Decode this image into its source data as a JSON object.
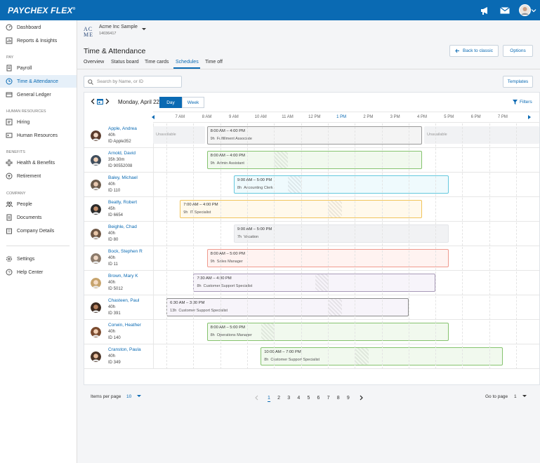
{
  "brand": {
    "logo_text": "PAYCHEX FLEX",
    "logo_mark": "®",
    "primary_color": "#0a6ab3"
  },
  "topbar": {
    "icons": [
      "megaphone-icon",
      "mail-icon",
      "avatar",
      "chevron-down-icon"
    ]
  },
  "sidebar": {
    "items_top": [
      {
        "label": "Dashboard",
        "icon": "dashboard-icon"
      },
      {
        "label": "Reports & Insights",
        "icon": "reports-icon"
      }
    ],
    "sections": [
      {
        "title": "PAY",
        "items": [
          {
            "label": "Payroll",
            "icon": "payroll-icon"
          },
          {
            "label": "Time & Attendance",
            "icon": "clock-icon",
            "active": true
          },
          {
            "label": "General Ledger",
            "icon": "ledger-icon"
          }
        ]
      },
      {
        "title": "HUMAN RESOURCES",
        "items": [
          {
            "label": "Hiring",
            "icon": "hiring-icon"
          },
          {
            "label": "Human Resources",
            "icon": "hr-icon"
          }
        ]
      },
      {
        "title": "BENEFITS",
        "items": [
          {
            "label": "Health & Benefits",
            "icon": "health-icon"
          },
          {
            "label": "Retirement",
            "icon": "retirement-icon"
          }
        ]
      },
      {
        "title": "COMPANY",
        "items": [
          {
            "label": "People",
            "icon": "people-icon"
          },
          {
            "label": "Documents",
            "icon": "documents-icon"
          },
          {
            "label": "Company Details",
            "icon": "company-icon"
          }
        ]
      }
    ],
    "items_bottom": [
      {
        "label": "Settings",
        "icon": "gear-icon"
      },
      {
        "label": "Help Center",
        "icon": "help-icon"
      }
    ]
  },
  "company": {
    "logo_line1": "AC",
    "logo_line2": "ME",
    "name": "Acme Inc Sample",
    "id": "14036417"
  },
  "page": {
    "title": "Time & Attendance",
    "back_label": "Back to classic",
    "options_label": "Options"
  },
  "tabs": [
    "Overview",
    "Status board",
    "Time cards",
    "Schedules",
    "Time off"
  ],
  "active_tab": "Schedules",
  "toolbar": {
    "search_placeholder": "Search by Name, or ID",
    "templates_label": "Templates"
  },
  "schedule": {
    "date_label": "Monday, April 22",
    "view_day": "Day",
    "view_week": "Week",
    "active_view": "Day",
    "filters_label": "Filters",
    "hours": [
      "7 AM",
      "8 AM",
      "9 AM",
      "10 AM",
      "11 AM",
      "12 PM",
      "1 PM",
      "2 PM",
      "3 PM",
      "4 PM",
      "5 PM",
      "6 PM",
      "7 PM"
    ],
    "current_hour": "1 PM",
    "unavailable_label": "Unavailable",
    "employees": [
      {
        "name": "Apple, Andrea",
        "hours": "40h",
        "id": "ID Apple352",
        "shift": "8:00 AM – 4:00 PM",
        "detail": "9h",
        "role": "Fulfillment Associate",
        "start": 8.0,
        "end": 16.0,
        "break": null,
        "color": "#f4f4f4",
        "border": "#999999",
        "unavailable": true
      },
      {
        "name": "Arnold, David",
        "hours": "35h 30m",
        "id": "ID 90552008",
        "shift": "8:00 AM – 4:00 PM",
        "detail": "9h",
        "role": "Admin Assistant",
        "start": 8.0,
        "end": 16.0,
        "break": 10.5,
        "color": "#f1f9ee",
        "border": "#86c36f",
        "unavailable": false
      },
      {
        "name": "Baley, Michael",
        "hours": "40h",
        "id": "ID 110",
        "shift": "9:00 AM – 5:00 PM",
        "detail": "8h",
        "role": "Accounting Clerk",
        "start": 9.0,
        "end": 17.0,
        "break": 11.0,
        "color": "#effafd",
        "border": "#65c8de",
        "unavailable": false
      },
      {
        "name": "Beatty, Robert",
        "hours": "45h",
        "id": "ID 6654",
        "shift": "7:00 AM – 4:00 PM",
        "detail": "9h",
        "role": "IT Specialist",
        "start": 7.0,
        "end": 16.0,
        "break": 12.5,
        "color": "#fff9ec",
        "border": "#f1c45b",
        "unavailable": false
      },
      {
        "name": "Beighle, Chad",
        "hours": "40h",
        "id": "ID 80",
        "shift": "9:00 AM – 5:00 PM",
        "detail": "7h",
        "role": "Vacation",
        "start": 9.0,
        "end": 17.0,
        "break": null,
        "color": "#f1f2f4",
        "border": "#e3e5e8",
        "unavailable": false
      },
      {
        "name": "Bock, Stephen R",
        "hours": "40h",
        "id": "ID 11",
        "shift": "8:00 AM – 5:00 PM",
        "detail": "9h",
        "role": "Sales Manager",
        "start": 8.0,
        "end": 17.0,
        "break": null,
        "color": "#fff3f1",
        "border": "#ef9a8e",
        "unavailable": false
      },
      {
        "name": "Brown, Mary K",
        "hours": "40h",
        "id": "ID 5012",
        "shift": "7:30 AM – 4:30 PM",
        "detail": "8h",
        "role": "Customer Support Specialist",
        "start": 7.5,
        "end": 16.5,
        "break": 12.0,
        "color": "#f7f4fa",
        "border": "#a89ab8",
        "unavailable": false
      },
      {
        "name": "Chasteen, Paul",
        "hours": "40h",
        "id": "ID 391",
        "shift": "6:30 AM – 3:30 PM",
        "detail": "13h",
        "role": "Customer Support Specialist",
        "start": 6.5,
        "end": 15.5,
        "break": 12.5,
        "color": "#f7f4fa",
        "border": "#8c8c8c",
        "unavailable": false
      },
      {
        "name": "Corwin, Heather",
        "hours": "40h",
        "id": "ID 140",
        "shift": "8:00 AM – 5:00 PM",
        "detail": "8h",
        "role": "Operations Manager",
        "start": 8.0,
        "end": 17.0,
        "break": 10.0,
        "color": "#f1f9ee",
        "border": "#86c36f",
        "unavailable": false
      },
      {
        "name": "Cranston, Paula",
        "hours": "40h",
        "id": "ID 349",
        "shift": "10:00 AM – 7:00 PM",
        "detail": "8h",
        "role": "Customer Support Specialist",
        "start": 10.0,
        "end": 19.0,
        "break": 13.5,
        "color": "#f1f9ee",
        "border": "#86c36f",
        "unavailable": false
      }
    ]
  },
  "pagination": {
    "items_per_page_label": "Items per page",
    "items_per_page_value": "10",
    "pages": [
      "1",
      "2",
      "3",
      "4",
      "5",
      "6",
      "7",
      "8",
      "9"
    ],
    "current_page": "1",
    "go_to_label": "Go to page",
    "go_to_value": "1"
  }
}
